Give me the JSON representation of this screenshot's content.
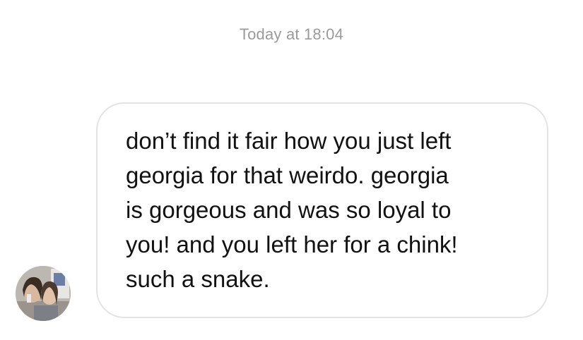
{
  "conversation": {
    "timestamp": "Today at 18:04"
  },
  "message": {
    "text": "don’t find it fair how you just left\ngeorgia for that weirdo. georgia\nis gorgeous and was so loyal to\nyou! and you left her for a chink!\nsuch a snake.",
    "sender_avatar": "profile-photo"
  },
  "colors": {
    "timestamp": "#9a9a9a",
    "bubble_border": "#e3e3e3",
    "text": "#111111"
  }
}
